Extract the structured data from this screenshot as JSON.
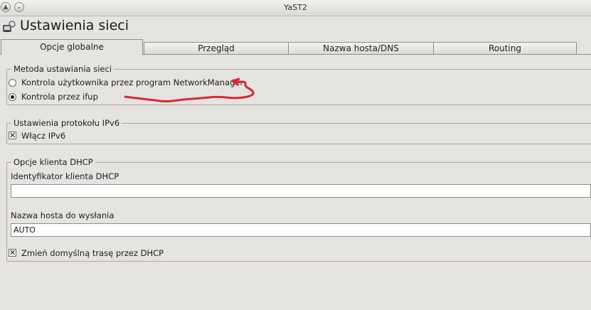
{
  "window": {
    "title": "YaST2"
  },
  "header": {
    "title": "Ustawienia sieci",
    "icon": "network-settings-icon"
  },
  "tabs": [
    {
      "label": "Opcje globalne",
      "active": true
    },
    {
      "label": "Przegląd",
      "active": false
    },
    {
      "label": "Nazwa hosta/DNS",
      "active": false
    },
    {
      "label": "Routing",
      "active": false
    }
  ],
  "method_group": {
    "legend": "Metoda ustawiania sieci",
    "options": [
      {
        "label": "Kontrola użytkownika przez program NetworkManager",
        "selected": false
      },
      {
        "label": "Kontrola przez ifup",
        "selected": true
      }
    ]
  },
  "ipv6_group": {
    "legend": "Ustawienia protokołu IPv6",
    "enable_ipv6": {
      "label": "Włącz IPv6",
      "checked": true
    }
  },
  "dhcp_group": {
    "legend": "Opcje klienta DHCP",
    "client_id": {
      "label": "Identyfikator klienta DHCP",
      "value": ""
    },
    "hostname": {
      "label": "Nazwa hosta do wysłania",
      "value": "AUTO"
    },
    "default_route": {
      "label": "Zmień domyślną trasę przez DHCP",
      "checked": true
    }
  },
  "colors": {
    "annotation": "#d9282f",
    "background": "#e6e4e1"
  }
}
